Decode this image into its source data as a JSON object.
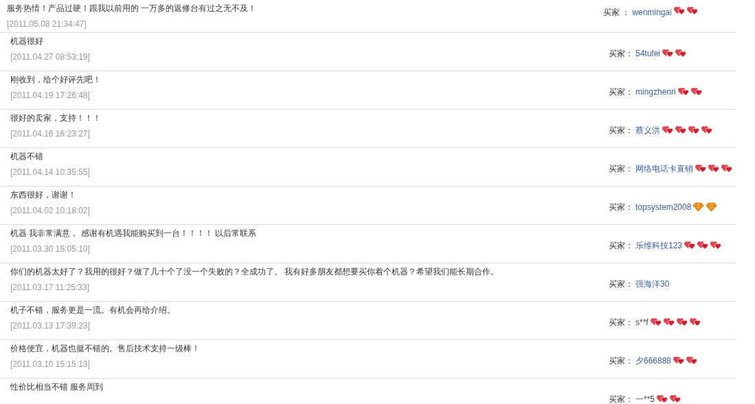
{
  "reviews": [
    {
      "comment": "服务热情！产品过硬！跟我以前用的 一万多的返修台有过之无不及！",
      "date": "[2011.05.08 21:34:47]",
      "buyer_label": "买家 ：",
      "buyer": "wenmingai",
      "linked": true,
      "badges": [
        {
          "kind": "heart"
        },
        {
          "kind": "heart"
        }
      ]
    },
    {
      "comment": "机器很好",
      "date": "[2011.04.27 08:53:19]",
      "buyer_label": "买家：",
      "buyer": "54tufei",
      "linked": true,
      "badges": [
        {
          "kind": "heart"
        },
        {
          "kind": "heart"
        }
      ]
    },
    {
      "comment": "刚收到，给个好评先吧！",
      "date": "[2011.04.19 17:26:48]",
      "buyer_label": "买家：",
      "buyer": "mingzhenri",
      "linked": true,
      "badges": [
        {
          "kind": "heart"
        },
        {
          "kind": "heart"
        }
      ]
    },
    {
      "comment": "很好的卖家，支持！！！",
      "date": "[2011.04.16 16:23:27]",
      "buyer_label": "买家：",
      "buyer": "蔡义洪",
      "linked": true,
      "badges": [
        {
          "kind": "heart"
        },
        {
          "kind": "heart"
        },
        {
          "kind": "heart"
        },
        {
          "kind": "heart"
        }
      ]
    },
    {
      "comment": "机器不错",
      "date": "[2011.04.14 10:35:55]",
      "buyer_label": "买家：",
      "buyer": "网络电话卡直销",
      "linked": true,
      "badges": [
        {
          "kind": "heart"
        },
        {
          "kind": "heart"
        },
        {
          "kind": "heart"
        }
      ]
    },
    {
      "comment": "东西很好，谢谢！",
      "date": "[2011.04.02 10:18:02]",
      "buyer_label": "买家：",
      "buyer": "topsystem2008",
      "linked": true,
      "badges": [
        {
          "kind": "diamond"
        },
        {
          "kind": "diamond"
        }
      ]
    },
    {
      "comment": "机器 我非常满意， 感谢有机遇我能购买到一台！！！！ 以后常联系",
      "date": "[2011.03.30 15:05:10]",
      "buyer_label": "买家：",
      "buyer": "乐维科技123",
      "linked": true,
      "badges": [
        {
          "kind": "heart"
        },
        {
          "kind": "heart"
        },
        {
          "kind": "heart"
        }
      ]
    },
    {
      "comment": "你们的机器太好了？我用的很好？做了几十个了没一个失败的？全成功了。 我有好多朋友都想要买你着个机器？希望我们能长期合作。",
      "date": "[2011.03.17 11:25:33]",
      "buyer_label": "买家：",
      "buyer": "强海洋30",
      "linked": true
    },
    {
      "comment": "机子不错，服务更是一流。有机会再给介绍。",
      "date": "[2011.03.13 17:39:23]",
      "buyer_label": "买家：",
      "buyer": "s**f",
      "linked": false,
      "badges": [
        {
          "kind": "heart"
        },
        {
          "kind": "heart"
        },
        {
          "kind": "heart"
        },
        {
          "kind": "heart"
        }
      ]
    },
    {
      "comment": "价格便宜，机器也挺不错的。售后技术支持一级棒！",
      "date": "[2011.03.10 15:15:13]",
      "buyer_label": "买家：",
      "buyer": "夕666888",
      "linked": true,
      "badges": [
        {
          "kind": "heart"
        },
        {
          "kind": "heart"
        }
      ]
    },
    {
      "comment": "性价比相当不错 服务周到",
      "buyer_label": "买家：",
      "buyer": "一**5",
      "linked": false,
      "badges": [
        {
          "kind": "heart"
        },
        {
          "kind": "heart"
        }
      ]
    }
  ]
}
